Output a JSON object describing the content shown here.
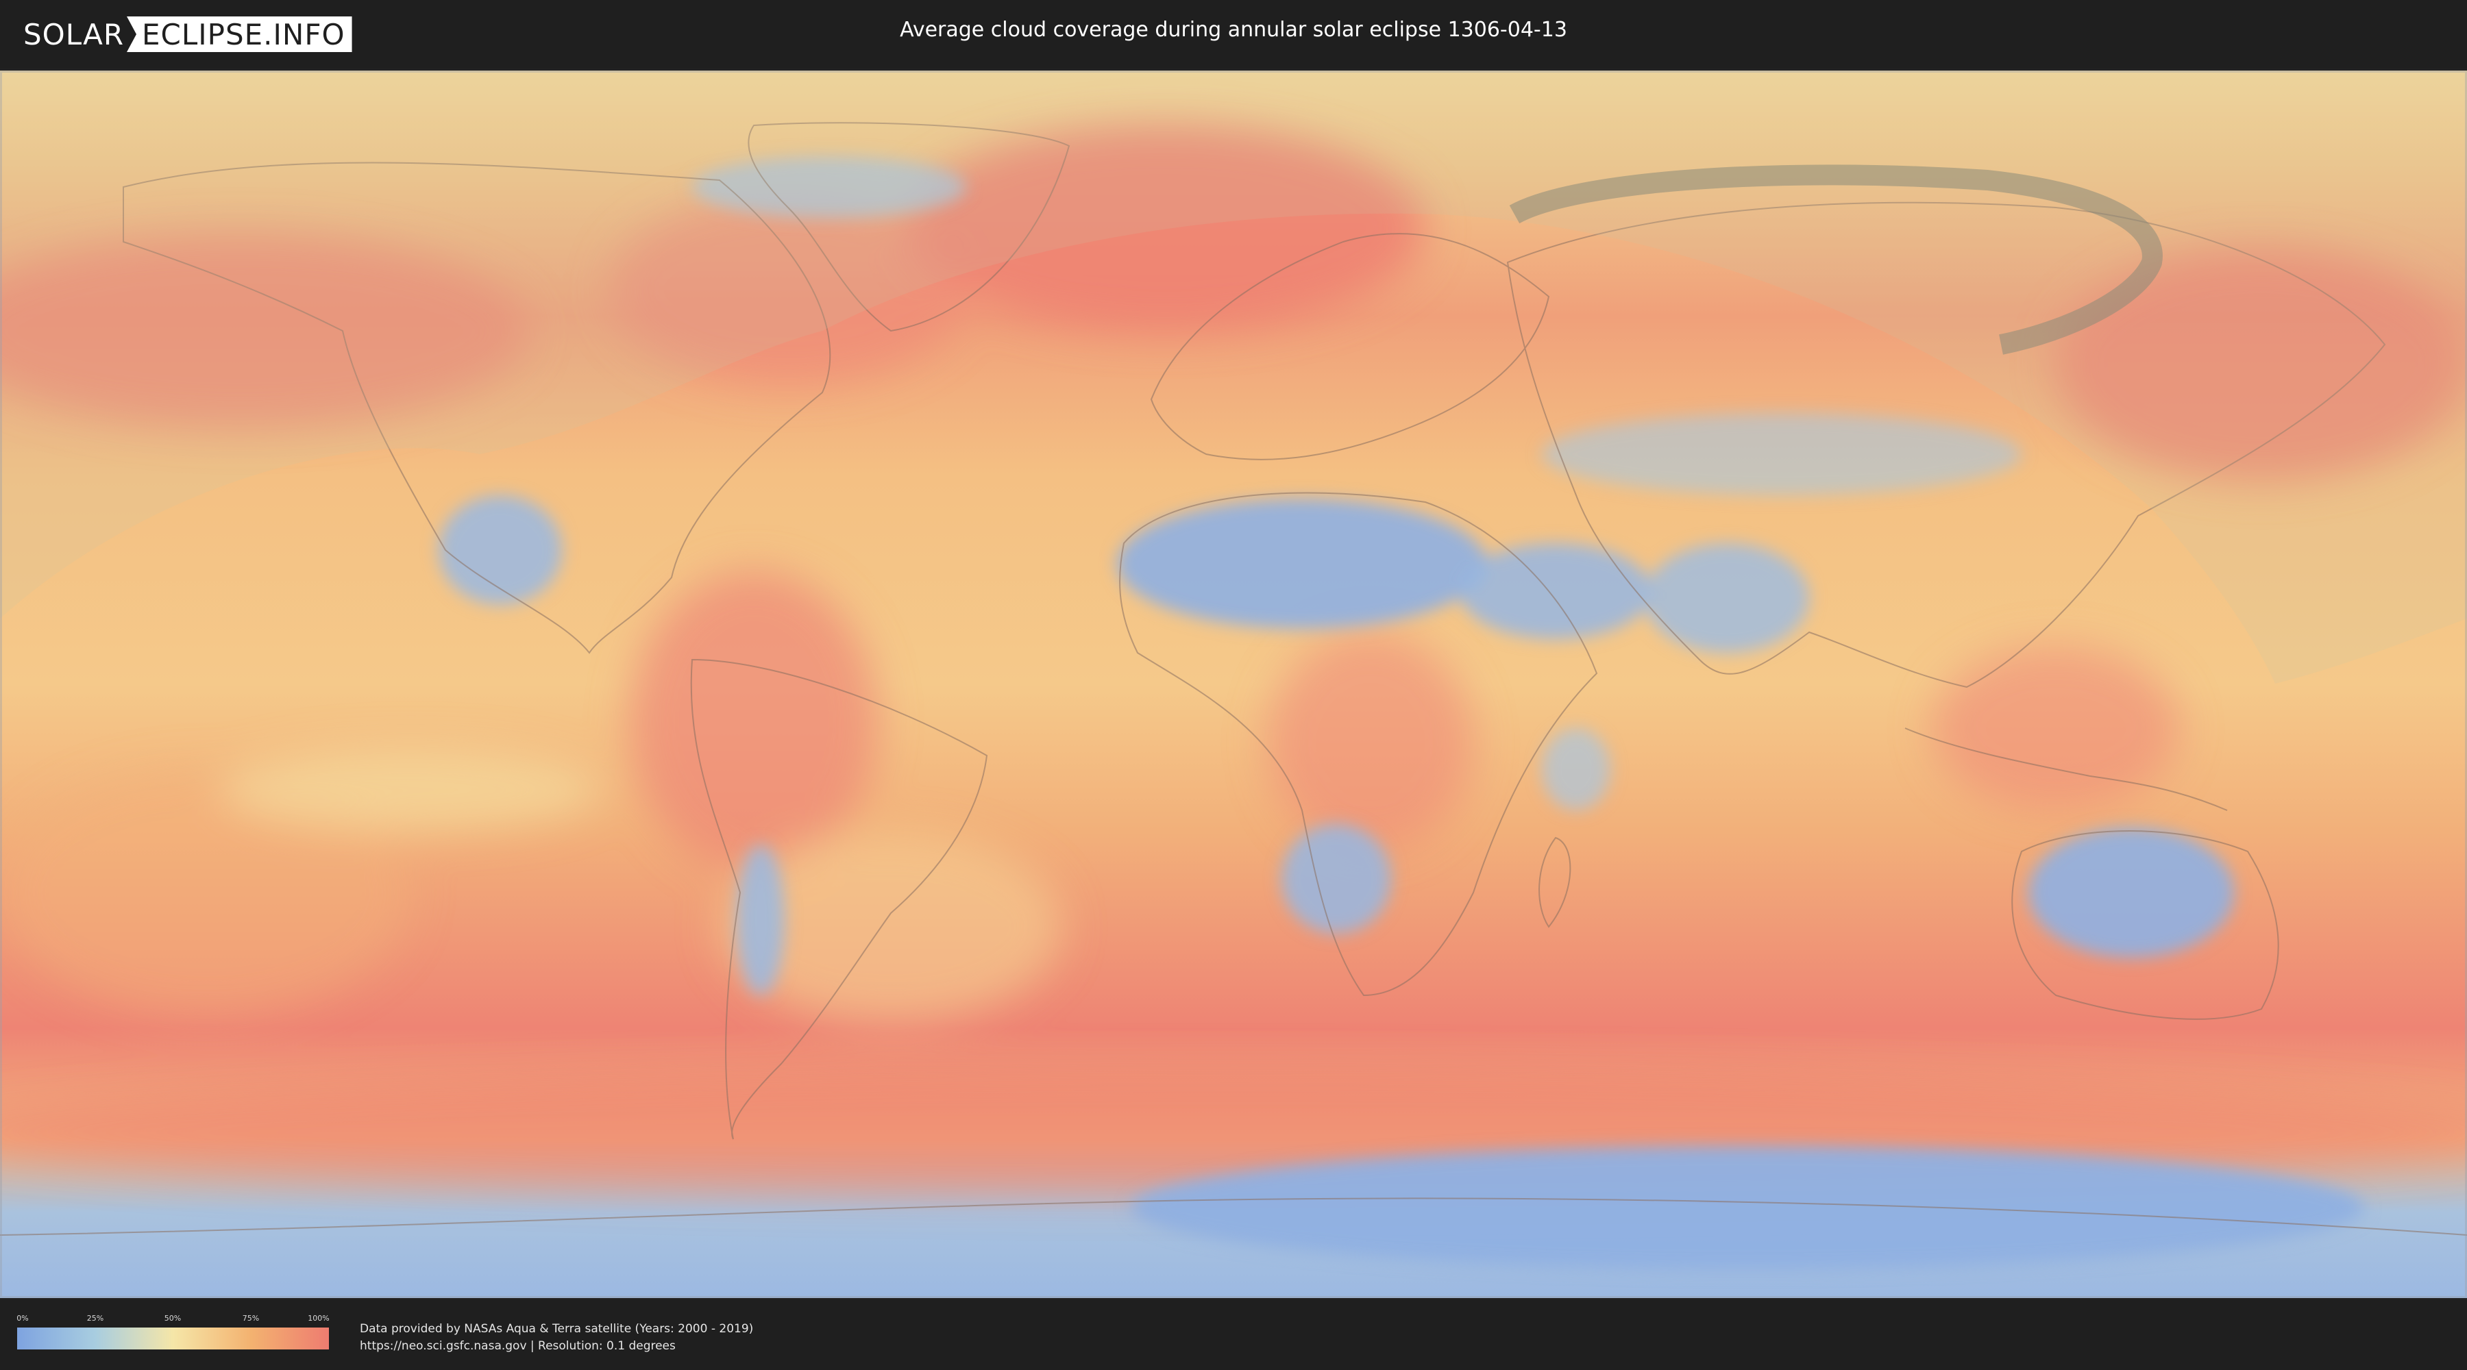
{
  "header": {
    "logo_left": "SOLAR",
    "logo_right": "ECLIPSE.INFO",
    "title": "Average cloud coverage during annular solar eclipse 1306-04-13"
  },
  "legend": {
    "ticks": [
      "0%",
      "25%",
      "50%",
      "75%",
      "100%"
    ],
    "colors": [
      "#7ea3e0",
      "#a8cde0",
      "#f5e6a8",
      "#f3b270",
      "#ee7c70"
    ]
  },
  "footer": {
    "credit_line1": "Data provided by NASAs Aqua & Terra satellite (Years: 2000 - 2019)",
    "credit_line2": "https://neo.sci.gsfc.nasa.gov | Resolution: 0.1 degrees"
  },
  "map": {
    "projection": "equirectangular",
    "cloud_colors": {
      "clear": "#7ea3e0",
      "low": "#a8cde0",
      "mid": "#f5e6a8",
      "high": "#f3b270",
      "overcast": "#ee7c70"
    },
    "eclipse_overlay_color": "#8a8a78"
  }
}
